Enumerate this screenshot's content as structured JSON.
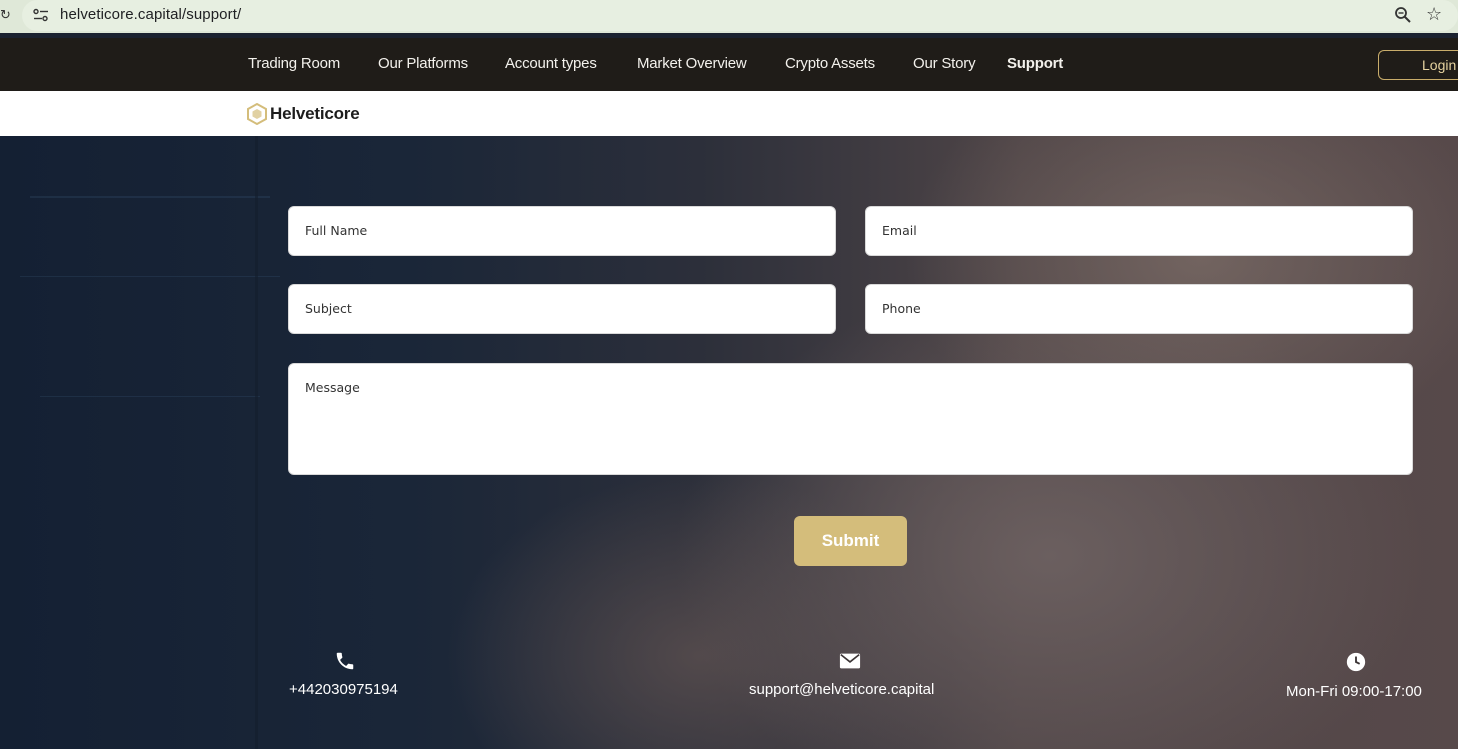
{
  "browser": {
    "url": "helveticore.capital/support/"
  },
  "nav": {
    "items": [
      {
        "label": "Trading Room"
      },
      {
        "label": "Our Platforms"
      },
      {
        "label": "Account types"
      },
      {
        "label": "Market Overview"
      },
      {
        "label": "Crypto Assets"
      },
      {
        "label": "Our Story"
      },
      {
        "label": "Support",
        "active": true
      }
    ],
    "login_label": "Login"
  },
  "brand": {
    "name": "Helveticore",
    "accent_color": "#d4bd7b"
  },
  "form": {
    "full_name_placeholder": "Full Name",
    "email_placeholder": "Email",
    "subject_placeholder": "Subject",
    "phone_placeholder": "Phone",
    "message_placeholder": "Message",
    "submit_label": "Submit"
  },
  "contacts": {
    "phone": {
      "icon": "phone-icon",
      "text": "+442030975194"
    },
    "email": {
      "icon": "mail-icon",
      "text": "support@helveticore.capital"
    },
    "hours": {
      "icon": "clock-icon",
      "text": "Mon-Fri 09:00-17:00"
    }
  }
}
